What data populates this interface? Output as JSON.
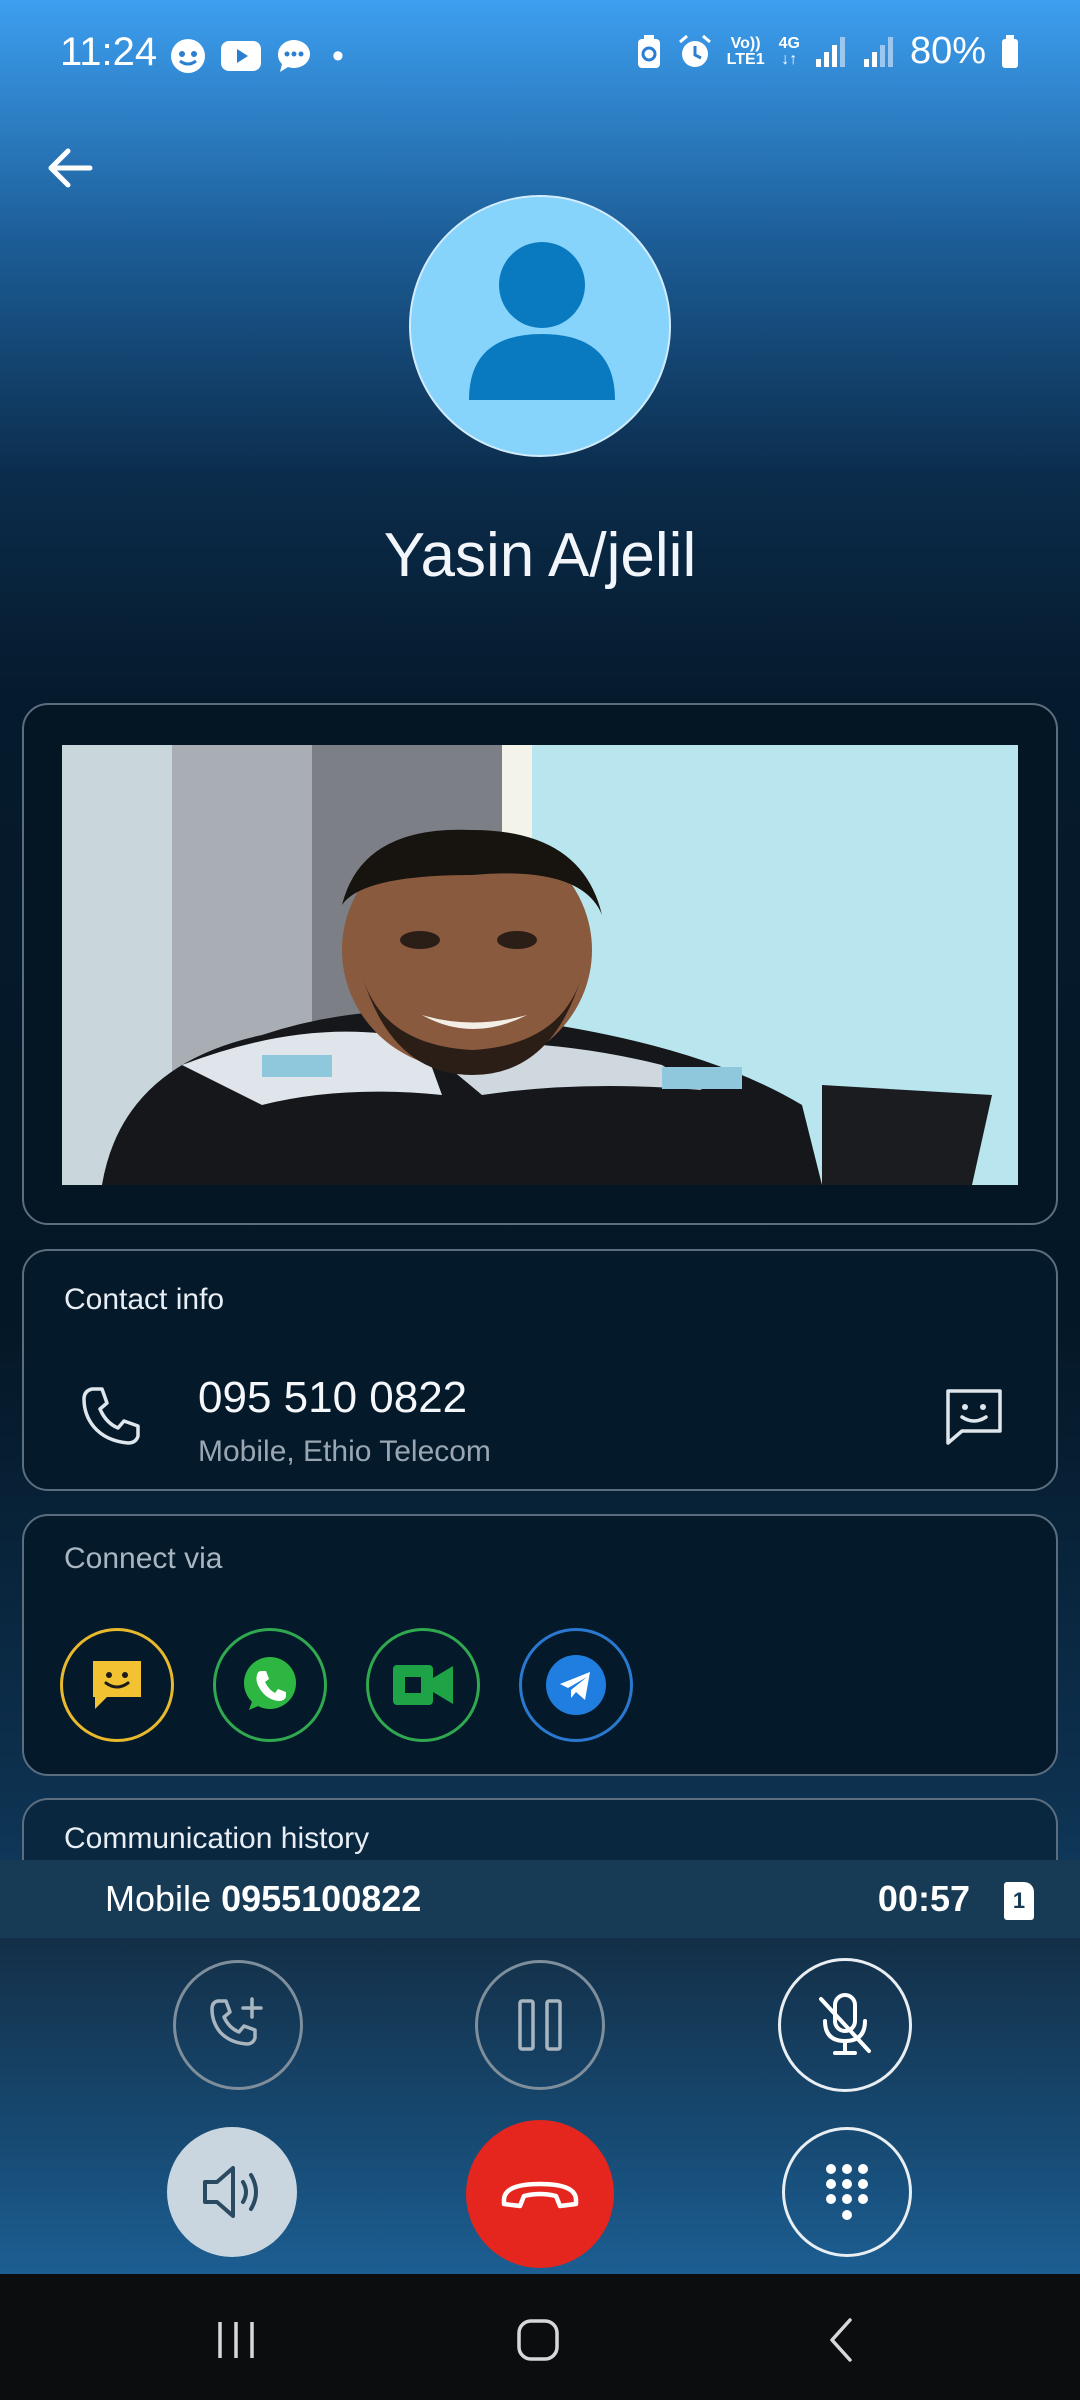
{
  "status_bar": {
    "time": "11:24",
    "dot": "•",
    "network_volte": "Vo))",
    "network_lte": "LTE1",
    "network_4g": "4G",
    "battery": "80%"
  },
  "contact": {
    "name": "Yasin A/jelil"
  },
  "contact_info": {
    "title": "Contact info",
    "phone_number": "095 510 0822",
    "phone_type": "Mobile, Ethio Telecom"
  },
  "connect_via": {
    "title": "Connect via",
    "apps": [
      "messages-app-icon",
      "whatsapp-icon",
      "google-meet-icon",
      "telegram-icon"
    ]
  },
  "communication_history": {
    "title": "Communication history"
  },
  "call_bar": {
    "label": "Mobile",
    "number": "0955100822",
    "timer": "00:57",
    "sim": "1"
  },
  "colors": {
    "end_call": "#e5261e",
    "speaker_active": "#c9d6df",
    "avatar_bg": "#86d3fb",
    "avatar_fg": "#0a7ac0"
  }
}
